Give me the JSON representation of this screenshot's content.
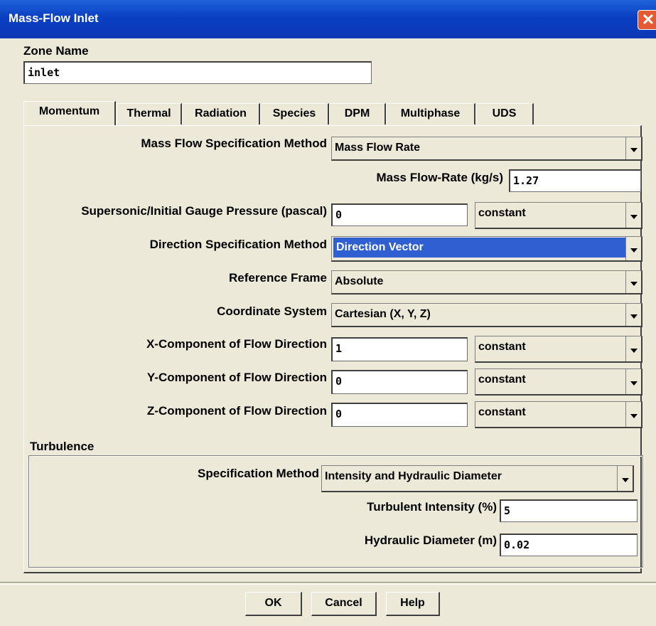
{
  "window": {
    "title": "Mass-Flow Inlet",
    "close_glyph": "✕"
  },
  "zone": {
    "label": "Zone Name",
    "value": "inlet"
  },
  "tabs": [
    "Momentum",
    "Thermal",
    "Radiation",
    "Species",
    "DPM",
    "Multiphase",
    "UDS"
  ],
  "active_tab": "Momentum",
  "momentum": {
    "mass_flow_spec": {
      "label": "Mass Flow Specification Method",
      "value": "Mass Flow Rate"
    },
    "mass_flow_rate": {
      "label": "Mass Flow-Rate (kg/s)",
      "value": "1.27"
    },
    "gauge_pressure": {
      "label": "Supersonic/Initial Gauge Pressure (pascal)",
      "value": "0",
      "profile": "constant"
    },
    "direction_spec": {
      "label": "Direction Specification Method",
      "value": "Direction Vector"
    },
    "reference_frame": {
      "label": "Reference Frame",
      "value": "Absolute"
    },
    "coordinate_system": {
      "label": "Coordinate System",
      "value": "Cartesian (X, Y, Z)"
    },
    "x_component": {
      "label": "X-Component of Flow Direction",
      "value": "1",
      "profile": "constant"
    },
    "y_component": {
      "label": "Y-Component of Flow Direction",
      "value": "0",
      "profile": "constant"
    },
    "z_component": {
      "label": "Z-Component of Flow Direction",
      "value": "0",
      "profile": "constant"
    }
  },
  "turbulence": {
    "group_label": "Turbulence",
    "spec_method": {
      "label": "Specification Method",
      "value": "Intensity and Hydraulic Diameter"
    },
    "intensity": {
      "label": "Turbulent Intensity (%)",
      "value": "5"
    },
    "hydraulic_diameter": {
      "label": "Hydraulic Diameter (m)",
      "value": "0.02"
    }
  },
  "buttons": {
    "ok": "OK",
    "cancel": "Cancel",
    "help": "Help"
  },
  "colors": {
    "titlebar": "#0a3fc2",
    "dialog_bg": "#ece9d8",
    "selection": "#2f5fd0",
    "close": "#e35a35"
  }
}
